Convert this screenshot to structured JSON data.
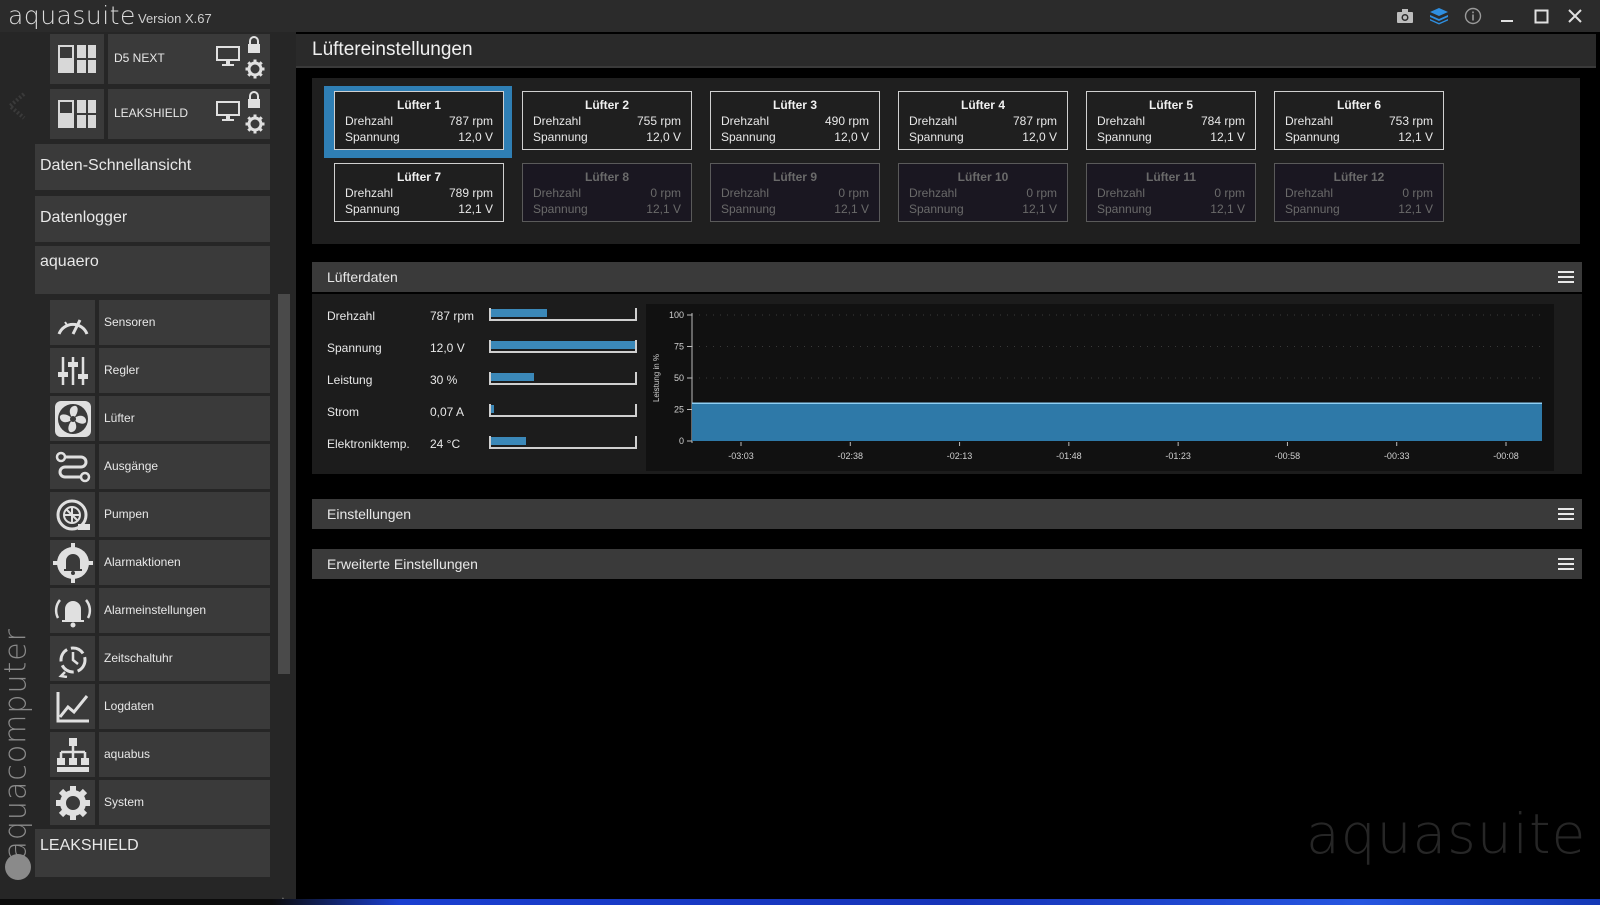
{
  "app": {
    "name": "aquasuite",
    "version": "Version X.67"
  },
  "titlebar_icons": [
    "camera-icon",
    "layers-icon",
    "info-icon",
    "minimize-icon",
    "maximize-icon",
    "close-icon"
  ],
  "colors": {
    "accent": "#2f7fb5",
    "bar_fill": "#3b88b8",
    "panel": "#3a3a3a",
    "background": "#000000"
  },
  "sidebar": {
    "brand": "aquacomputer",
    "devices": [
      {
        "label": "D5 NEXT"
      },
      {
        "label": "LEAKSHIELD"
      }
    ],
    "quick_view": "Daten-Schnellansicht",
    "logger": "Datenlogger",
    "group": "aquaero",
    "items": [
      {
        "label": "Sensoren",
        "icon": "gauge-icon"
      },
      {
        "label": "Regler",
        "icon": "sliders-icon"
      },
      {
        "label": "Lüfter",
        "icon": "fan-icon"
      },
      {
        "label": "Ausgänge",
        "icon": "outputs-icon"
      },
      {
        "label": "Pumpen",
        "icon": "pump-icon"
      },
      {
        "label": "Alarmaktionen",
        "icon": "alarm-bell-icon"
      },
      {
        "label": "Alarmeinstellungen",
        "icon": "alarm-settings-icon"
      },
      {
        "label": "Zeitschaltuhr",
        "icon": "timer-icon"
      },
      {
        "label": "Logdaten",
        "icon": "log-chart-icon"
      },
      {
        "label": "aquabus",
        "icon": "network-icon"
      },
      {
        "label": "System",
        "icon": "gear-icon"
      }
    ],
    "bottom_group": "LEAKSHIELD"
  },
  "main": {
    "title": "Lüftereinstellungen",
    "fan_key_speed": "Drehzahl",
    "fan_key_voltage": "Spannung",
    "fans": [
      {
        "name": "Lüfter 1",
        "rpm": "787 rpm",
        "volt": "12,0 V"
      },
      {
        "name": "Lüfter 2",
        "rpm": "755 rpm",
        "volt": "12,0 V"
      },
      {
        "name": "Lüfter 3",
        "rpm": "490 rpm",
        "volt": "12,0 V"
      },
      {
        "name": "Lüfter 4",
        "rpm": "787 rpm",
        "volt": "12,0 V"
      },
      {
        "name": "Lüfter 5",
        "rpm": "784 rpm",
        "volt": "12,1 V"
      },
      {
        "name": "Lüfter 6",
        "rpm": "753 rpm",
        "volt": "12,1 V"
      },
      {
        "name": "Lüfter 7",
        "rpm": "789 rpm",
        "volt": "12,1 V"
      },
      {
        "name": "Lüfter 8",
        "rpm": "0 rpm",
        "volt": "12,1 V"
      },
      {
        "name": "Lüfter 9",
        "rpm": "0 rpm",
        "volt": "12,1 V"
      },
      {
        "name": "Lüfter 10",
        "rpm": "0 rpm",
        "volt": "12,1 V"
      },
      {
        "name": "Lüfter 11",
        "rpm": "0 rpm",
        "volt": "12,1 V"
      },
      {
        "name": "Lüfter 12",
        "rpm": "0 rpm",
        "volt": "12,1 V"
      }
    ],
    "selected_fan": "Lüfter 1",
    "sections": {
      "data": "Lüfterdaten",
      "settings": "Einstellungen",
      "advanced": "Erweiterte Einstellungen"
    },
    "fan_data": [
      {
        "label": "Drehzahl",
        "value": "787 rpm",
        "level": 0.39
      },
      {
        "label": "Spannung",
        "value": "12,0 V",
        "level": 1.0
      },
      {
        "label": "Leistung",
        "value": "30 %",
        "level": 0.3
      },
      {
        "label": "Strom",
        "value": "0,07 A",
        "level": 0.02
      },
      {
        "label": "Elektroniktemp.",
        "value": "24 °C",
        "level": 0.24
      }
    ],
    "watermark": "aquasuite"
  },
  "chart_data": {
    "type": "area",
    "title": "",
    "ylabel": "Leistung in %",
    "xlabel": "",
    "ylim": [
      0,
      100
    ],
    "yticks": [
      0,
      25,
      50,
      75,
      100
    ],
    "xticks": [
      "-03:03",
      "-02:38",
      "-02:13",
      "-01:48",
      "-01:23",
      "-00:58",
      "-00:33",
      "-00:08"
    ],
    "x_range_seconds": [
      -206,
      0
    ],
    "series": [
      {
        "x": [
          -206,
          0
        ],
        "values": [
          30,
          30
        ]
      }
    ],
    "grid": true
  }
}
